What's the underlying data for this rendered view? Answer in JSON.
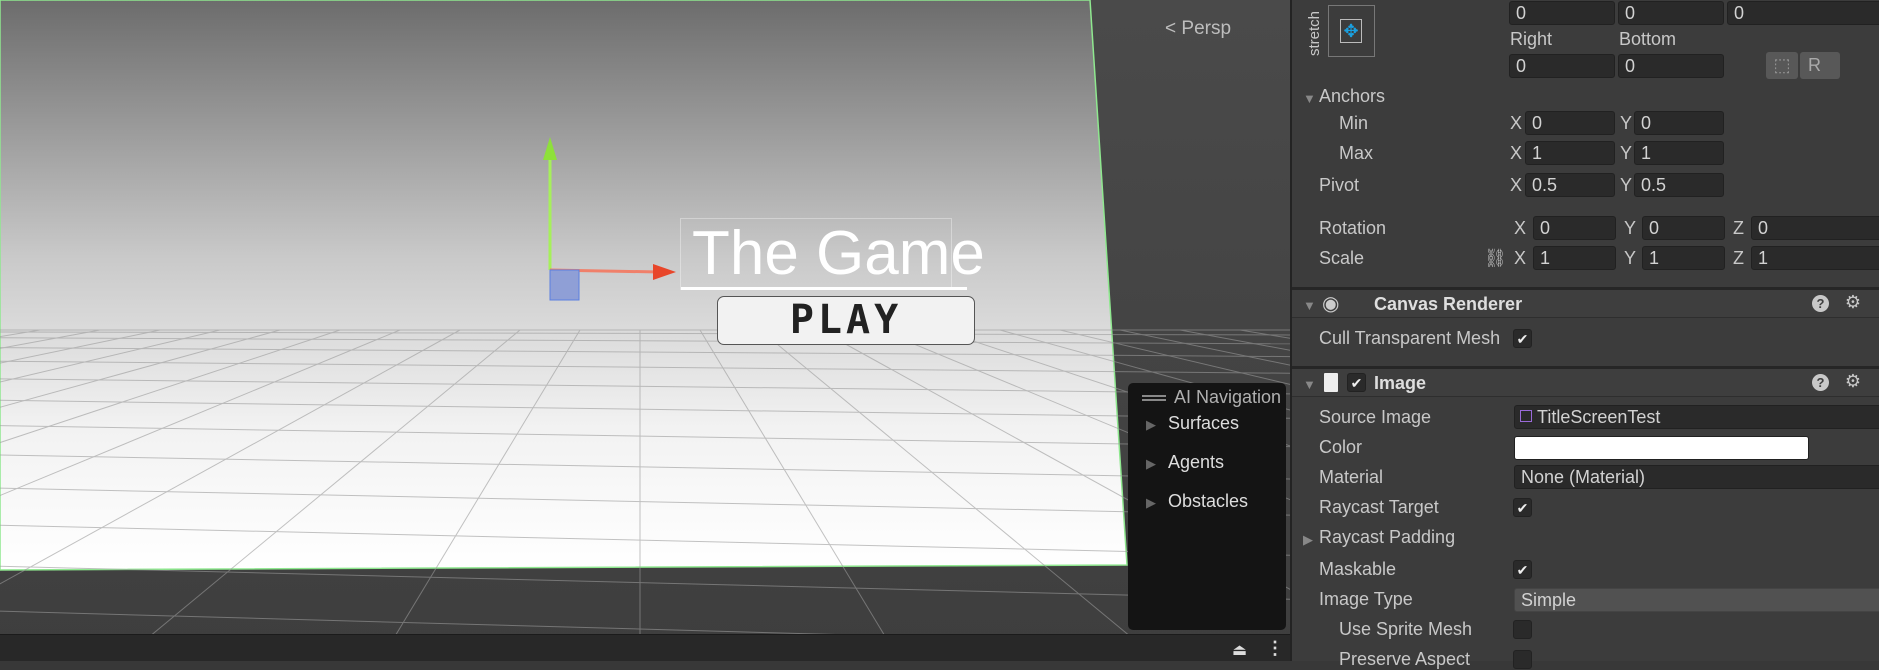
{
  "scene": {
    "persp_label": "Persp",
    "title_text": "The Game",
    "play_label": "PLAY",
    "ai_navigation": {
      "title": "AI Navigation",
      "items": [
        "Surfaces",
        "Agents",
        "Obstacles"
      ]
    }
  },
  "inspector": {
    "rect": {
      "stretch_label": "stretch",
      "top_values": [
        "0",
        "0",
        "0"
      ],
      "right_label": "Right",
      "bottom_label": "Bottom",
      "right_value": "0",
      "bottom_value": "0",
      "anchors_label": "Anchors",
      "min_label": "Min",
      "max_label": "Max",
      "min": {
        "x": "0",
        "y": "0"
      },
      "max": {
        "x": "1",
        "y": "1"
      },
      "pivot_label": "Pivot",
      "pivot": {
        "x": "0.5",
        "y": "0.5"
      },
      "rotation_label": "Rotation",
      "rotation": {
        "x": "0",
        "y": "0",
        "z": "0"
      },
      "scale_label": "Scale",
      "scale": {
        "x": "1",
        "y": "1",
        "z": "1"
      },
      "axis": {
        "x": "X",
        "y": "Y",
        "z": "Z"
      }
    },
    "canvas_renderer": {
      "title": "Canvas Renderer",
      "cull_label": "Cull Transparent Mesh",
      "cull": true
    },
    "image": {
      "title": "Image",
      "enabled": true,
      "source_image_label": "Source Image",
      "source_image": "TitleScreenTest",
      "color_label": "Color",
      "color": "#ffffff",
      "material_label": "Material",
      "material": "None (Material)",
      "raycast_target_label": "Raycast Target",
      "raycast_target": true,
      "raycast_padding_label": "Raycast Padding",
      "maskable_label": "Maskable",
      "maskable": true,
      "image_type_label": "Image Type",
      "image_type": "Simple",
      "use_sprite_mesh_label": "Use Sprite Mesh",
      "use_sprite_mesh": false,
      "preserve_aspect_label": "Preserve Aspect",
      "preserve_aspect": false
    }
  }
}
